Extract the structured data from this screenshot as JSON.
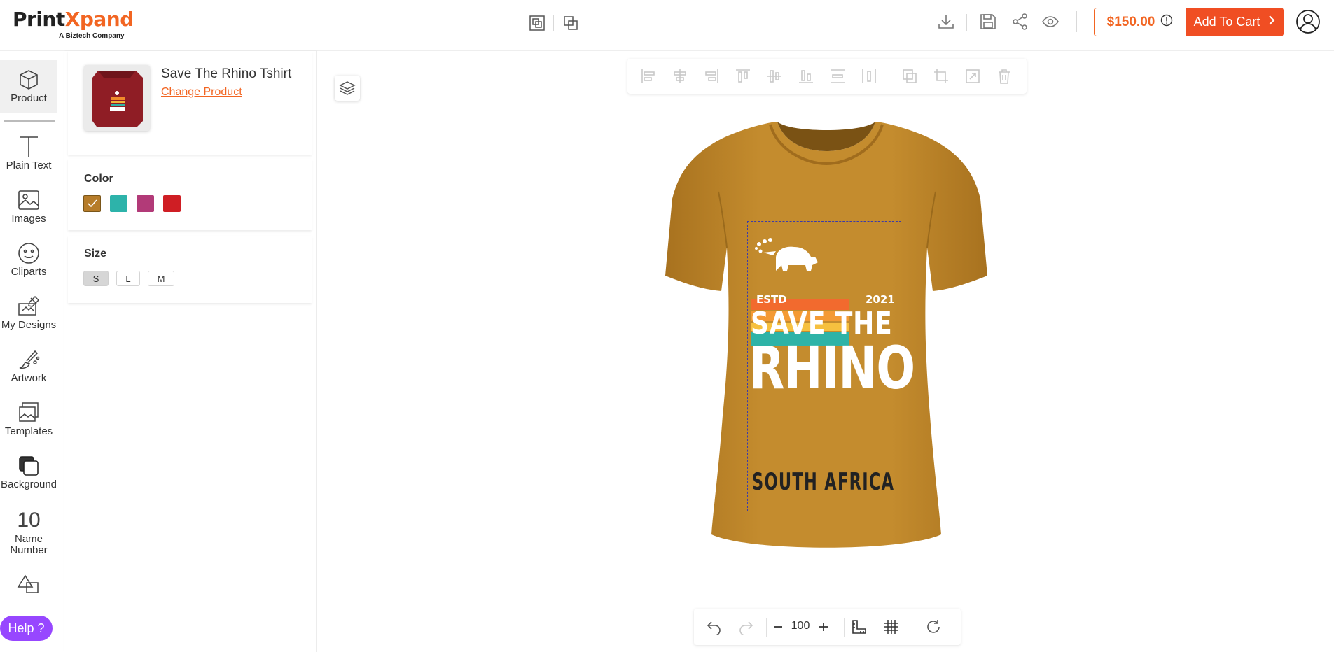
{
  "app": {
    "logo_main_a": "Print",
    "logo_main_b": "Xpand",
    "logo_sub": "A Biztech Company"
  },
  "header": {
    "icons": [
      "group-icon",
      "ungroup-icon",
      "download-icon",
      "save-icon",
      "share-icon",
      "preview-icon",
      "info-icon",
      "user-icon"
    ],
    "price": "$150.00",
    "add_to_cart": "Add To Cart",
    "accent": "#f04e23"
  },
  "sidebar": {
    "items": [
      {
        "label": "Product",
        "icon": "cube-icon"
      },
      {
        "label": "Plain Text",
        "icon": "text-icon"
      },
      {
        "label": "Images",
        "icon": "image-icon"
      },
      {
        "label": "Cliparts",
        "icon": "smiley-icon"
      },
      {
        "label": "My Designs",
        "icon": "my-designs-icon"
      },
      {
        "label": "Artwork",
        "icon": "artwork-icon"
      },
      {
        "label": "Templates",
        "icon": "templates-icon"
      },
      {
        "label": "Background",
        "icon": "background-icon"
      },
      {
        "label": "Name Number",
        "icon": "name-number-icon",
        "number": "10"
      },
      {
        "label": "",
        "icon": "shapes-icon"
      }
    ],
    "help": "Help ?"
  },
  "product": {
    "name": "Save The Rhino Tshirt",
    "change_link": "Change Product",
    "color_title": "Color",
    "colors": [
      "#b67c2a",
      "#2db3aa",
      "#b23a78",
      "#cf1e24"
    ],
    "selected_color": "#b67c2a",
    "size_title": "Size",
    "sizes": [
      "S",
      "L",
      "M"
    ],
    "selected_size": "S"
  },
  "toolbar": {
    "icons": [
      "align-left-icon",
      "align-center-icon",
      "align-right-icon",
      "align-top-icon",
      "align-middle-icon",
      "align-bottom-icon",
      "distribute-vertical-icon",
      "distribute-horizontal-icon",
      "duplicate-icon",
      "crop-icon",
      "resize-icon",
      "delete-icon"
    ]
  },
  "zoom": {
    "value": "100",
    "icons": [
      "undo-icon",
      "redo-icon",
      "zoom-out-icon",
      "zoom-in-icon",
      "ruler-icon",
      "grid-icon",
      "reset-icon"
    ]
  },
  "design": {
    "estd": "ESTD",
    "year": "2021",
    "line1": "SAVE THE",
    "line2": "RHINO",
    "line3": "SOUTH AFRICA",
    "shirt_color": "#c18a2c"
  }
}
